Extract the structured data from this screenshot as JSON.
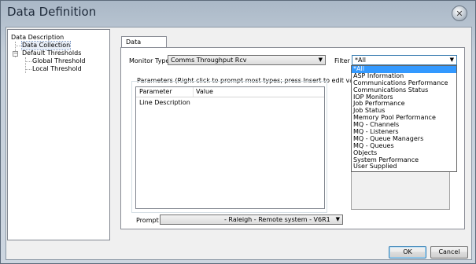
{
  "window": {
    "title": "Data Definition"
  },
  "tree": {
    "items": [
      {
        "label": "Data Description"
      },
      {
        "label": "Data Collection"
      },
      {
        "label": "Default Thresholds"
      },
      {
        "label": "Global Threshold"
      },
      {
        "label": "Local Threshold"
      }
    ]
  },
  "tabs": [
    {
      "label": "Data Collection"
    }
  ],
  "monitor_type": {
    "label": "Monitor Type",
    "value": "Comms Throughput Rcv"
  },
  "filter": {
    "label": "Filter",
    "value": "*All",
    "options": [
      "*All",
      "ASP Information",
      "Communications Performance",
      "Communications Status",
      "IOP Monitors",
      "Job Performance",
      "Job Status",
      "Memory Pool Performance",
      "MQ - Channels",
      "MQ - Listeners",
      "MQ - Queue Managers",
      "MQ - Queues",
      "Objects",
      "System Performance",
      "User Supplied"
    ],
    "selected_index": 0
  },
  "parameters": {
    "group_label": "Parameters (Right click to prompt most types; press Insert to edit value)",
    "columns": [
      "Parameter",
      "Value"
    ],
    "rows": [
      {
        "parameter": "Line Description",
        "value": ""
      }
    ]
  },
  "prompt": {
    "label": "Prompt",
    "value": "- Raleigh     - Remote system  - V6R1"
  },
  "buttons": {
    "ok": "OK",
    "cancel": "Cancel"
  }
}
